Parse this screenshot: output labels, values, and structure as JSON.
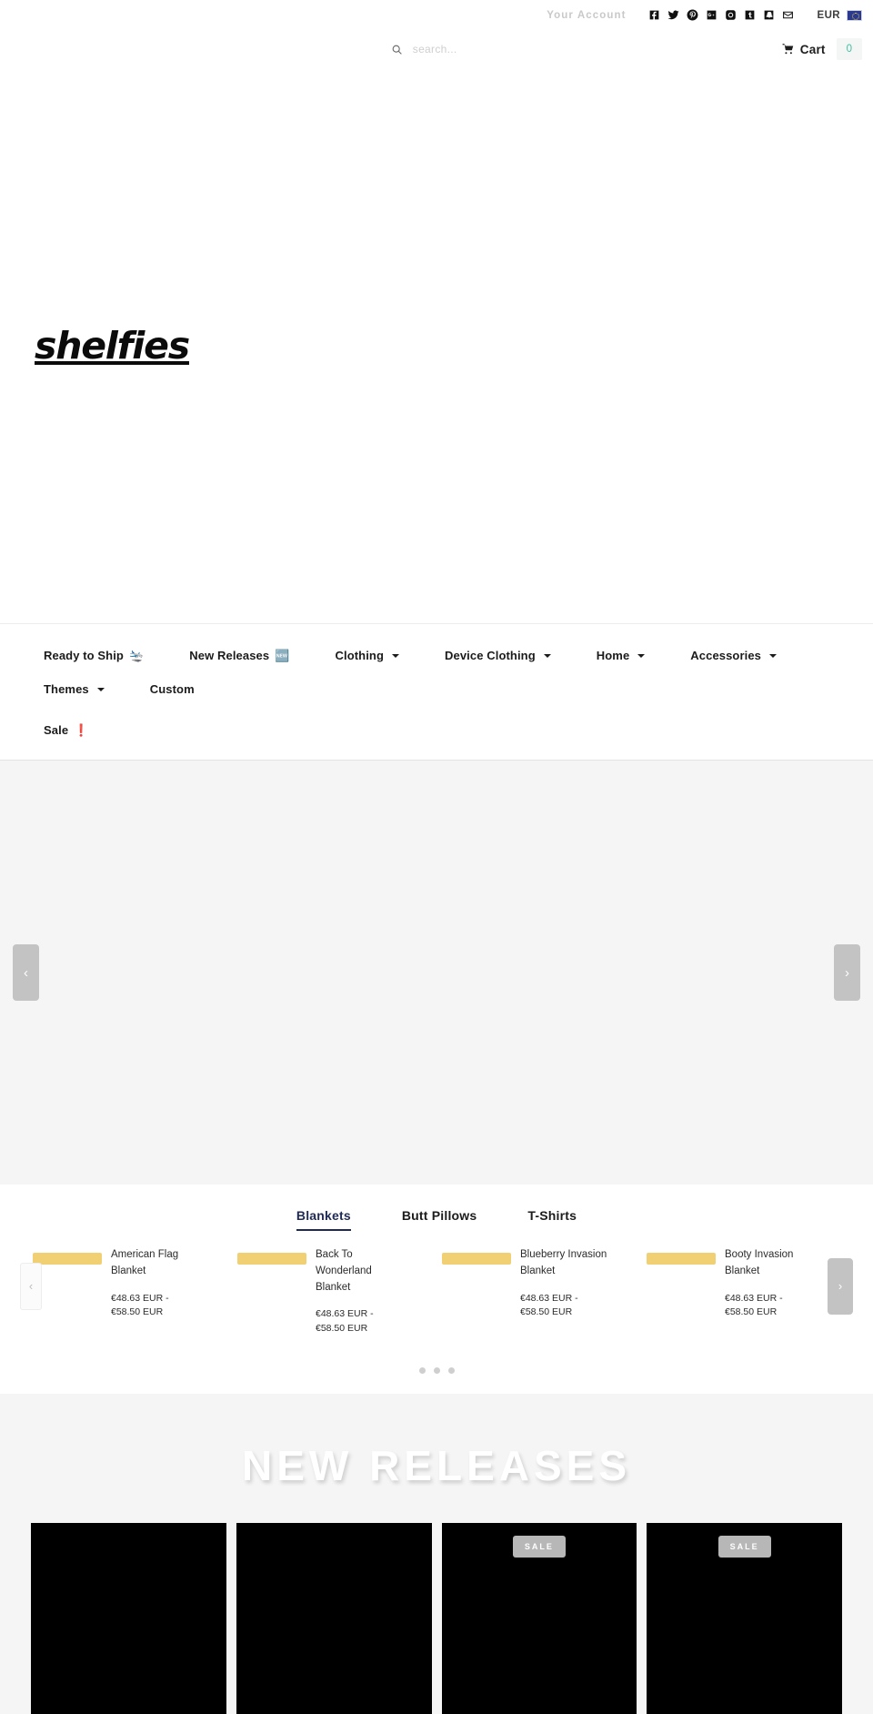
{
  "utility": {
    "account_label": "Your Account",
    "social": [
      {
        "name": "facebook-icon",
        "label": "Facebook"
      },
      {
        "name": "twitter-icon",
        "label": "Twitter"
      },
      {
        "name": "pinterest-icon",
        "label": "Pinterest"
      },
      {
        "name": "googleplus-icon",
        "label": "Google Plus"
      },
      {
        "name": "instagram-icon",
        "label": "Instagram"
      },
      {
        "name": "tumblr-icon",
        "label": "Tumblr"
      },
      {
        "name": "snapchat-icon",
        "label": "Snapchat"
      },
      {
        "name": "email-icon",
        "label": "Email"
      }
    ],
    "currency_code": "EUR",
    "currency_flag": "eu-flag-icon"
  },
  "search": {
    "placeholder": "search...",
    "value": "",
    "icon": "search-icon"
  },
  "cart": {
    "label": "Cart",
    "count": "0",
    "icon": "shopping-cart-icon",
    "count_color": "#3fc1a0"
  },
  "brand": {
    "logo_text": "shelfies"
  },
  "nav": {
    "row1": [
      {
        "label": "Ready to Ship",
        "emoji": "🛬",
        "has_chevron": false
      },
      {
        "label": "New Releases",
        "emoji": "🆕",
        "has_chevron": false
      },
      {
        "label": "Clothing",
        "emoji": "",
        "has_chevron": true
      },
      {
        "label": "Device Clothing",
        "emoji": "",
        "has_chevron": true
      },
      {
        "label": "Home",
        "emoji": "",
        "has_chevron": true
      },
      {
        "label": "Accessories",
        "emoji": "",
        "has_chevron": true
      },
      {
        "label": "Themes",
        "emoji": "",
        "has_chevron": true
      },
      {
        "label": "Custom",
        "emoji": "",
        "has_chevron": false
      }
    ],
    "row2": [
      {
        "label": "Sale",
        "emoji": "❗",
        "has_chevron": false
      }
    ]
  },
  "hero": {
    "prev_glyph": "‹",
    "next_glyph": "›"
  },
  "product_tabs": {
    "tabs": [
      {
        "label": "Blankets",
        "active": true
      },
      {
        "label": "Butt Pillows",
        "active": false
      },
      {
        "label": "T-Shirts",
        "active": false
      }
    ]
  },
  "product_carousel": {
    "prev_glyph": "‹",
    "next_glyph": "›",
    "dots": 3,
    "active_dot": 0,
    "products": [
      {
        "title": "American Flag Blanket",
        "price": "€48.63 EUR - €58.50 EUR"
      },
      {
        "title": "Back To Wonderland Blanket",
        "price": "€48.63 EUR - €58.50 EUR"
      },
      {
        "title": "Blueberry Invasion Blanket",
        "price": "€48.63 EUR - €58.50 EUR"
      },
      {
        "title": "Booty Invasion Blanket",
        "price": "€48.63 EUR - €58.50 EUR"
      }
    ]
  },
  "new_releases": {
    "heading": "NEW RELEASES",
    "cards": [
      {
        "sale": false,
        "badge": ""
      },
      {
        "sale": false,
        "badge": ""
      },
      {
        "sale": true,
        "badge": "SALE"
      },
      {
        "sale": true,
        "badge": "SALE"
      }
    ]
  }
}
